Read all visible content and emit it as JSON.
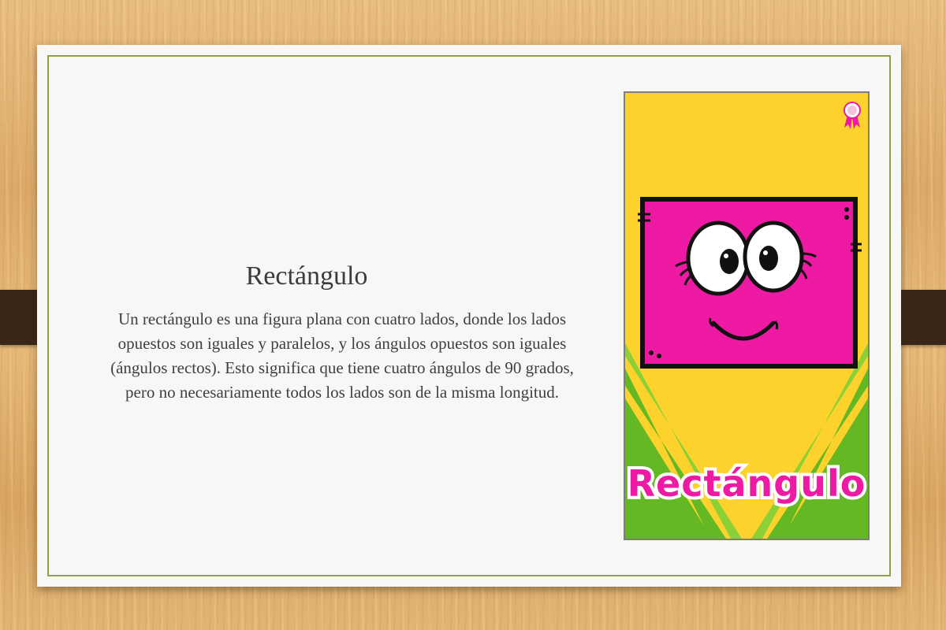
{
  "slide": {
    "title": "Rectángulo",
    "body": "Un rectángulo es una figura plana con cuatro lados, donde los lados opuestos son iguales y paralelos, y los ángulos opuestos son iguales (ángulos rectos). Esto significa que tiene cuatro ángulos de 90 grados, pero no necesariamente todos los lados son de la misma longitud."
  },
  "illustration": {
    "caption": "Rectángulo",
    "colors": {
      "background": "#fdd22c",
      "rectangle": "#ee1aa4",
      "stripes": "#63b823",
      "caption": "#ee1aa4"
    },
    "badge_icon": "award-ribbon-icon"
  }
}
